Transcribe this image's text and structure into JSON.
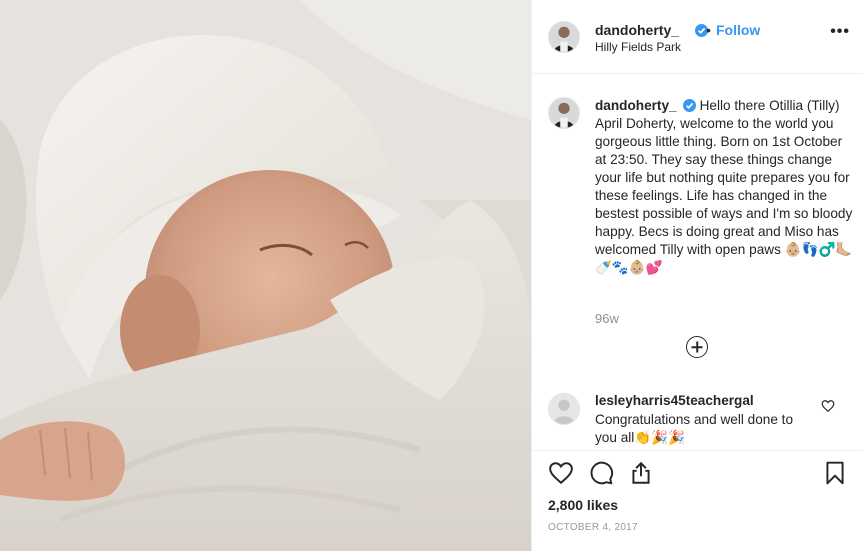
{
  "header": {
    "username": "dandoherty_",
    "separator": "•",
    "follow_label": "Follow",
    "location": "Hilly Fields Park",
    "more_icon": "more-options-icon"
  },
  "caption": {
    "username": "dandoherty_",
    "text": "Hello there Otillia (Tilly) April Doherty, welcome to the world you gorgeous little thing. Born on 1st October at 23:50. They say these things change your life but nothing quite prepares you for these feelings. Life has changed in the bestest possible of ways and I'm so bloody happy. Becs is doing great and Miso has welcomed Tilly with open paws 👶🏼👣♂️🦶🏼🍼🐾👶🏼💕",
    "time": "96w"
  },
  "comment": {
    "username": "lesleyharris45teachergal",
    "text": "Congratulations and well done to you all👏🎉🎉"
  },
  "actions": {
    "like_icon": "heart-icon",
    "comment_icon": "comment-icon",
    "share_icon": "share-icon",
    "save_icon": "bookmark-icon"
  },
  "likes": "2,800 likes",
  "date": "OCTOBER 4, 2017",
  "colors": {
    "link_blue": "#3897f0",
    "text": "#262626",
    "muted": "#8e8e8e",
    "border": "#efefef"
  }
}
